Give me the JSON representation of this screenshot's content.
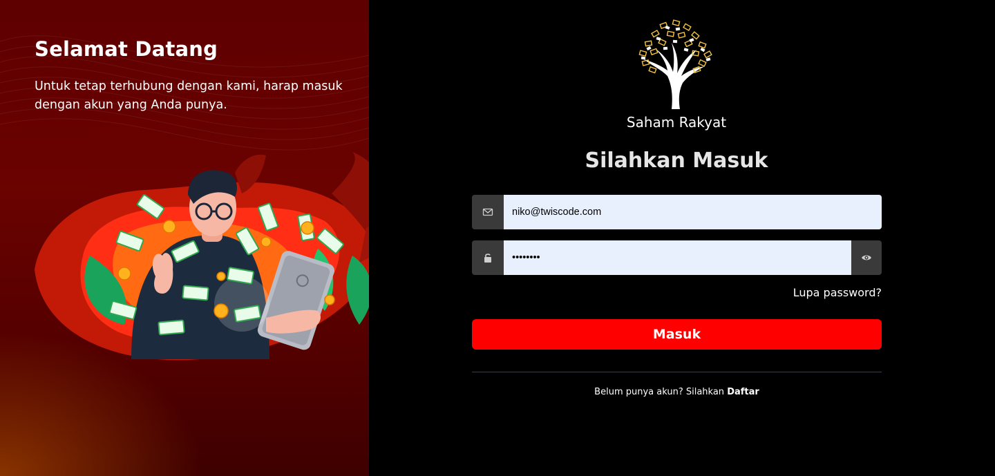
{
  "welcome": {
    "title": "Selamat Datang",
    "text": "Untuk tetap terhubung dengan kami, harap masuk dengan akun yang Anda punya."
  },
  "brand": {
    "name": "Saham Rakyat"
  },
  "form": {
    "title": "Silahkan Masuk",
    "email_value": "niko@twiscode.com",
    "password_value": "••••••••",
    "forgot_label": "Lupa password?",
    "submit_label": "Masuk",
    "register_prompt": "Belum punya akun? Silahkan ",
    "register_link": "Daftar"
  },
  "icons": {
    "email": "envelope-icon",
    "password": "unlock-icon",
    "toggle": "eye-icon"
  },
  "colors": {
    "accent": "#ff0000",
    "input_bg": "#e8f0fe",
    "addon_bg": "#3a3a3a",
    "left_bg": "#5e0000"
  }
}
